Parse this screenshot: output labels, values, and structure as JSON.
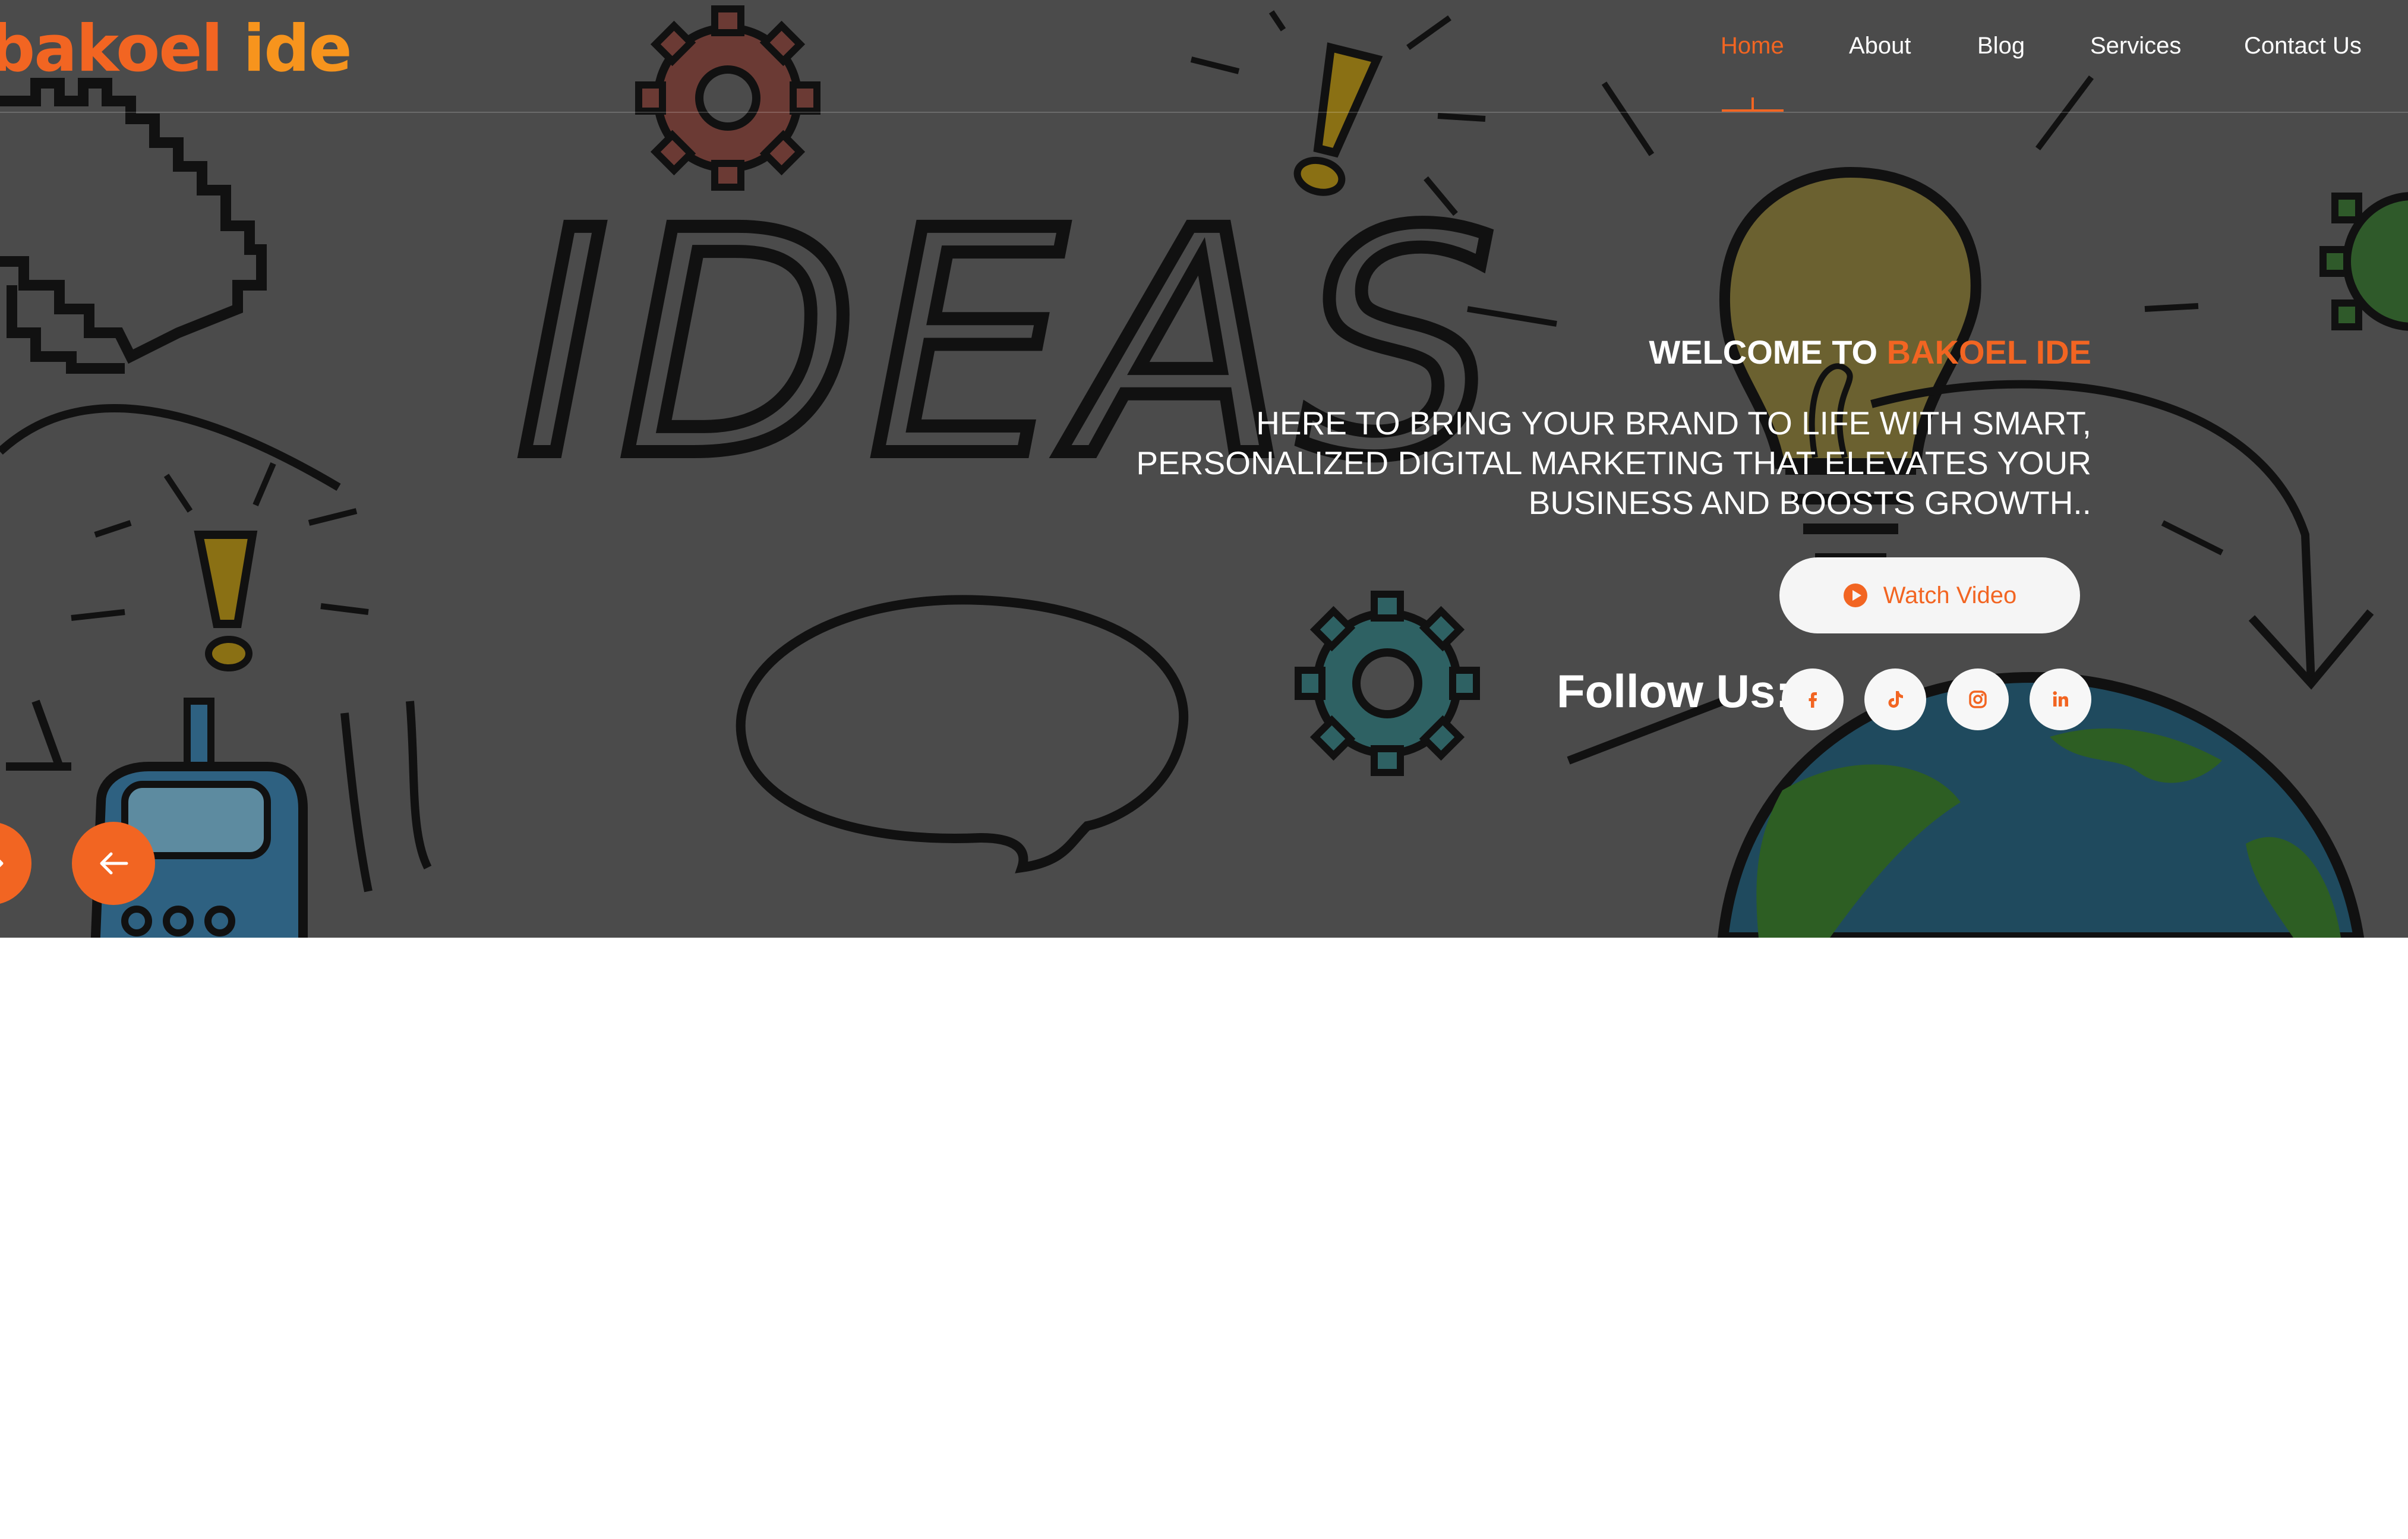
{
  "brand": {
    "logo_part_1": "bakoel",
    "logo_part_2": " ide"
  },
  "nav": {
    "items": [
      {
        "label": "Home",
        "active": true
      },
      {
        "label": "About",
        "active": false
      },
      {
        "label": "Blog",
        "active": false
      },
      {
        "label": "Services",
        "active": false
      },
      {
        "label": "Contact Us",
        "active": false
      }
    ]
  },
  "hero": {
    "background_doodle_text": "IDEAS",
    "welcome_prefix": "WELCOME TO",
    "welcome_brand": "BAKOEL IDE",
    "tagline": "HERE TO BRING YOUR BRAND TO LIFE WITH SMART, PERSONALIZED DIGITAL MARKETING THAT ELEVATES YOUR BUSINESS AND BOOSTS GROWTH..",
    "watch_video_label": "Watch Video",
    "watch_video_icon": "play-circle-icon",
    "follow_label": "Follow Us:",
    "social": [
      {
        "name": "facebook",
        "icon": "facebook-icon"
      },
      {
        "name": "tiktok",
        "icon": "tiktok-icon"
      },
      {
        "name": "instagram",
        "icon": "instagram-icon"
      },
      {
        "name": "linkedin",
        "icon": "linkedin-icon"
      }
    ],
    "slider_prev_icon": "arrow-right-icon",
    "slider_next_icon": "arrow-left-icon"
  },
  "colors": {
    "accent": "#f26522",
    "accent_light": "#f7941d",
    "hero_background": "#4b4b4b",
    "text": "#ffffff",
    "button_background": "#f5f5f5"
  }
}
